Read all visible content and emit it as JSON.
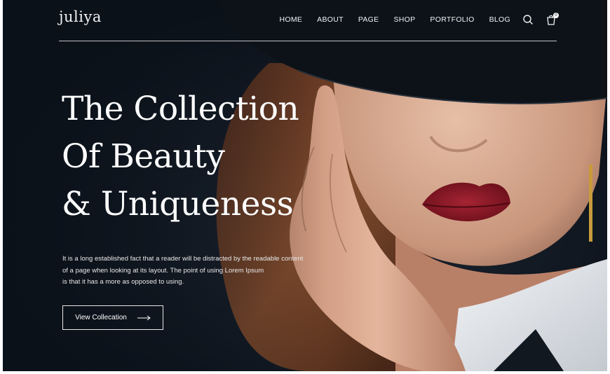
{
  "brand": {
    "logo_text": "juliya"
  },
  "nav": {
    "items": [
      "HOME",
      "ABOUT",
      "PAGE",
      "SHOP",
      "PORTFOLIO",
      "BLOG"
    ],
    "search_icon": "search-icon",
    "cart_icon": "shopping-bag-icon",
    "cart_count": "0"
  },
  "hero": {
    "title_lines": [
      "The Collection",
      "Of Beauty",
      "& Uniqueness"
    ],
    "description_lines": [
      "It is a long established fact that a reader will be distracted by the readable content",
      "of a page when looking at its layout. The point of using Lorem Ipsum",
      "is that it has a more as opposed to using."
    ],
    "cta_label": "View Collecation",
    "cta_icon": "arrow-right-icon"
  },
  "colors": {
    "background": "#0b1119",
    "text": "#ffffff",
    "lips": "#8e1a26",
    "skin": "#d7ab93"
  }
}
